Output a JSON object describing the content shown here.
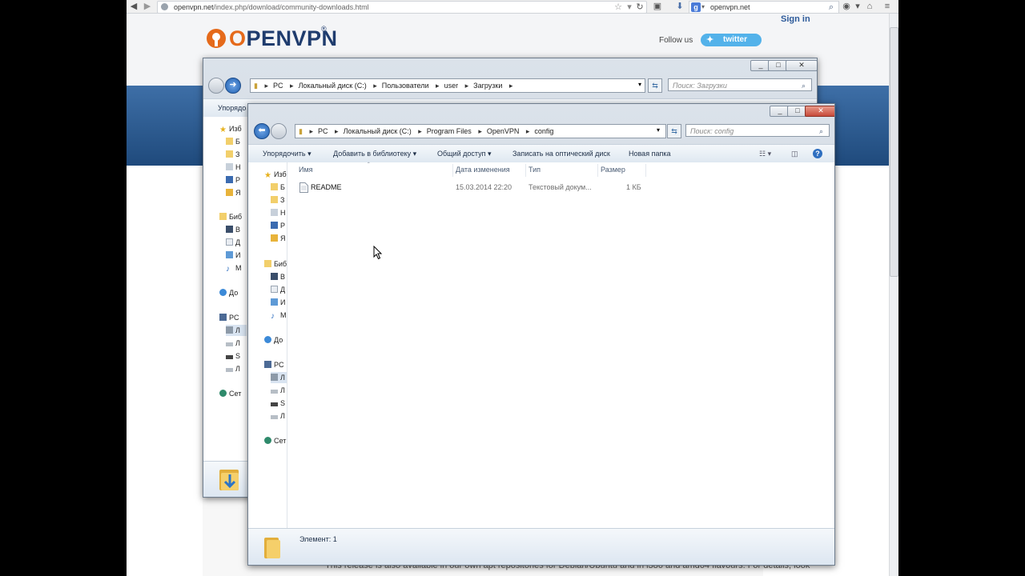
{
  "browser": {
    "url_host": "openvpn.net",
    "url_path": "/index.php/download/community-downloads.html",
    "search_engine_letter": "g",
    "search_text": "openvpn.net"
  },
  "site": {
    "logo": "OPENVPN",
    "logo_first": "O",
    "logo_rest": "PENVPN",
    "sign_in": "Sign in",
    "follow_us": "Follow us",
    "twitter": "twitter",
    "footer_text": "This release is also available in our own apt repositories for Debian/Ubuntu and in i386 and amd64 flavours. For details, look"
  },
  "back_window": {
    "breadcrumb": [
      "PC",
      "Локальный диск (C:)",
      "Пользователи",
      "user",
      "Загрузки"
    ],
    "search_placeholder": "Поиск: Загрузки",
    "cmd_organize": "Упорядо",
    "nav": [
      {
        "label": "Изб",
        "icon": "star-icon"
      },
      {
        "label": "Б",
        "icon": "folder-icon"
      },
      {
        "label": "З",
        "icon": "folder-icon"
      },
      {
        "label": "Н",
        "icon": "places-icon"
      },
      {
        "label": "Р",
        "icon": "desktop-icon"
      },
      {
        "label": "Я",
        "icon": "folder-icon"
      },
      {
        "label": "Биб",
        "icon": "library-icon"
      },
      {
        "label": "В",
        "icon": "video-icon"
      },
      {
        "label": "Д",
        "icon": "document-icon"
      },
      {
        "label": "И",
        "icon": "picture-icon"
      },
      {
        "label": "М",
        "icon": "music-icon"
      },
      {
        "label": "До",
        "icon": "homegroup-icon"
      },
      {
        "label": "PC",
        "icon": "computer-icon"
      },
      {
        "label": "Л",
        "icon": "drive-icon"
      },
      {
        "label": "Л",
        "icon": "drive-icon"
      },
      {
        "label": "S",
        "icon": "drive-icon"
      },
      {
        "label": "Л",
        "icon": "drive-icon"
      },
      {
        "label": "Сет",
        "icon": "network-icon"
      }
    ]
  },
  "front_window": {
    "breadcrumb": [
      "PC",
      "Локальный диск (C:)",
      "Program Files",
      "OpenVPN",
      "config"
    ],
    "search_placeholder": "Поиск: config",
    "commands": {
      "organize": "Упорядочить",
      "add_library": "Добавить в библиотеку",
      "share": "Общий доступ",
      "burn": "Записать на оптический диск",
      "new_folder": "Новая папка"
    },
    "columns": {
      "name": "Имя",
      "date": "Дата изменения",
      "type": "Тип",
      "size": "Размер"
    },
    "files": [
      {
        "name": "README",
        "date": "15.03.2014 22:20",
        "type": "Текстовый докум...",
        "size": "1 КБ"
      }
    ],
    "nav": [
      {
        "label": "Изб",
        "icon": "star-icon"
      },
      {
        "label": "Б",
        "icon": "folder-icon"
      },
      {
        "label": "З",
        "icon": "folder-icon"
      },
      {
        "label": "Н",
        "icon": "places-icon"
      },
      {
        "label": "Р",
        "icon": "desktop-icon"
      },
      {
        "label": "Я",
        "icon": "folder-icon"
      },
      {
        "label": "Биб",
        "icon": "library-icon"
      },
      {
        "label": "В",
        "icon": "video-icon"
      },
      {
        "label": "Д",
        "icon": "document-icon"
      },
      {
        "label": "И",
        "icon": "picture-icon"
      },
      {
        "label": "М",
        "icon": "music-icon"
      },
      {
        "label": "До",
        "icon": "homegroup-icon"
      },
      {
        "label": "PC",
        "icon": "computer-icon"
      },
      {
        "label": "Л",
        "icon": "drive-icon"
      },
      {
        "label": "Л",
        "icon": "drive-icon"
      },
      {
        "label": "S",
        "icon": "drive-icon"
      },
      {
        "label": "Л",
        "icon": "drive-icon"
      },
      {
        "label": "Сет",
        "icon": "network-icon"
      }
    ],
    "status": "Элемент: 1"
  },
  "colors": {
    "accent": "#2c5a9a",
    "logo_orange": "#e56a1b",
    "twitter": "#53b2ea"
  }
}
